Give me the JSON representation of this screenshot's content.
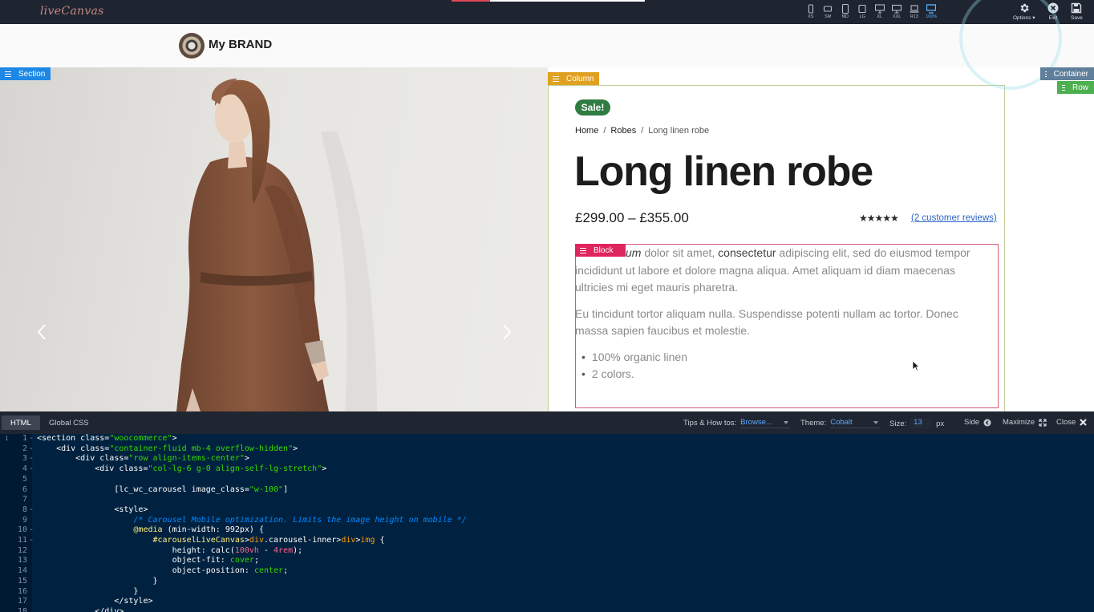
{
  "app": {
    "logo": "liveCanvas",
    "load_progress": 0.2
  },
  "toolbar": {
    "devices": [
      {
        "label": "XS",
        "icon": "phone-small-icon"
      },
      {
        "label": "SM",
        "icon": "phone-landscape-icon"
      },
      {
        "label": "MD",
        "icon": "tablet-icon"
      },
      {
        "label": "LG",
        "icon": "tablet-landscape-icon"
      },
      {
        "label": "XL",
        "icon": "desktop-icon"
      },
      {
        "label": "XXL",
        "icon": "wide-desktop-icon"
      },
      {
        "label": "R13",
        "icon": "laptop-icon"
      },
      {
        "label": "100%",
        "icon": "monitor-full-icon",
        "active": true
      }
    ],
    "options_label": "Options",
    "exit_label": "Exit",
    "save_label": "Save"
  },
  "header": {
    "brand_name": "My BRAND"
  },
  "editor_labels": {
    "section": "Section",
    "column": "Column",
    "container": "Container",
    "row": "Row",
    "block": "Block"
  },
  "colors": {
    "section_tag": "#1e88e5",
    "column_tag": "#e0a020",
    "container_tag": "#5f7f9a",
    "row_tag": "#4caf50",
    "block_tag": "#e0245e",
    "sale_badge": "#2f7c43",
    "code_bg": "#002240"
  },
  "product": {
    "sale_badge": "Sale!",
    "breadcrumb": {
      "home": "Home",
      "category": "Robes",
      "current": "Long linen robe",
      "separator": "/"
    },
    "title": "Long linen robe",
    "price": "£299.00 – £355.00",
    "rating_stars": "★★★★★",
    "rating_value": 5,
    "reviews_link": "(2 customer reviews)",
    "description": {
      "p1_em": "um",
      "p1_a": " dolor sit amet, ",
      "p1_bold": "consectetur",
      "p1_b": " adipiscing elit, sed do eiusmod tempor incididunt ut labore et dolore magna aliqua. Amet aliquam id diam maecenas ultricies mi eget mauris pharetra.",
      "p2": "Eu tincidunt tortor aliquam nulla. Suspendisse potenti nullam ac tortor. Donec massa sapien faucibus et molestie.",
      "features": [
        "100% organic linen",
        "2 colors."
      ]
    }
  },
  "panel": {
    "tabs": [
      "HTML",
      "Global CSS"
    ],
    "active_tab": "HTML",
    "tips_label": "Tips & How tos:",
    "tips_value": "Browse...",
    "theme_label": "Theme:",
    "theme_value": "Cobalt",
    "size_label": "Size:",
    "size_value": "13",
    "size_unit": "px",
    "side_label": "Side",
    "maximize_label": "Maximize",
    "close_label": "Close"
  },
  "code": {
    "lines": [
      {
        "n": "1",
        "fold": "-",
        "text": "<section class=\"woocommerce\">"
      },
      {
        "n": "2",
        "fold": "-",
        "text": "    <div class=\"container-fluid mb-4 overflow-hidden\">"
      },
      {
        "n": "3",
        "fold": "-",
        "text": "        <div class=\"row align-items-center\">"
      },
      {
        "n": "4",
        "fold": "-",
        "text": "            <div class=\"col-lg-6 g-0 align-self-lg-stretch\">"
      },
      {
        "n": "5",
        "fold": "",
        "text": ""
      },
      {
        "n": "6",
        "fold": "",
        "text": "                [lc_wc_carousel image_class=\"w-100\"]"
      },
      {
        "n": "7",
        "fold": "",
        "text": ""
      },
      {
        "n": "8",
        "fold": "-",
        "text": "                <style>"
      },
      {
        "n": "9",
        "fold": "",
        "text": "                    /* Carousel Mobile optimization. Limits the image height on mobile */"
      },
      {
        "n": "10",
        "fold": "-",
        "text": "                    @media (min-width: 992px) {"
      },
      {
        "n": "11",
        "fold": "-",
        "text": "                        #carouselLiveCanvas>div.carousel-inner>div>img {"
      },
      {
        "n": "12",
        "fold": "",
        "text": "                            height: calc(100vh - 4rem);"
      },
      {
        "n": "13",
        "fold": "",
        "text": "                            object-fit: cover;"
      },
      {
        "n": "14",
        "fold": "",
        "text": "                            object-position: center;"
      },
      {
        "n": "15",
        "fold": "",
        "text": "                        }"
      },
      {
        "n": "16",
        "fold": "",
        "text": "                    }"
      },
      {
        "n": "17",
        "fold": "",
        "text": "                </style>"
      },
      {
        "n": "18",
        "fold": "",
        "text": "            </div>"
      }
    ]
  }
}
